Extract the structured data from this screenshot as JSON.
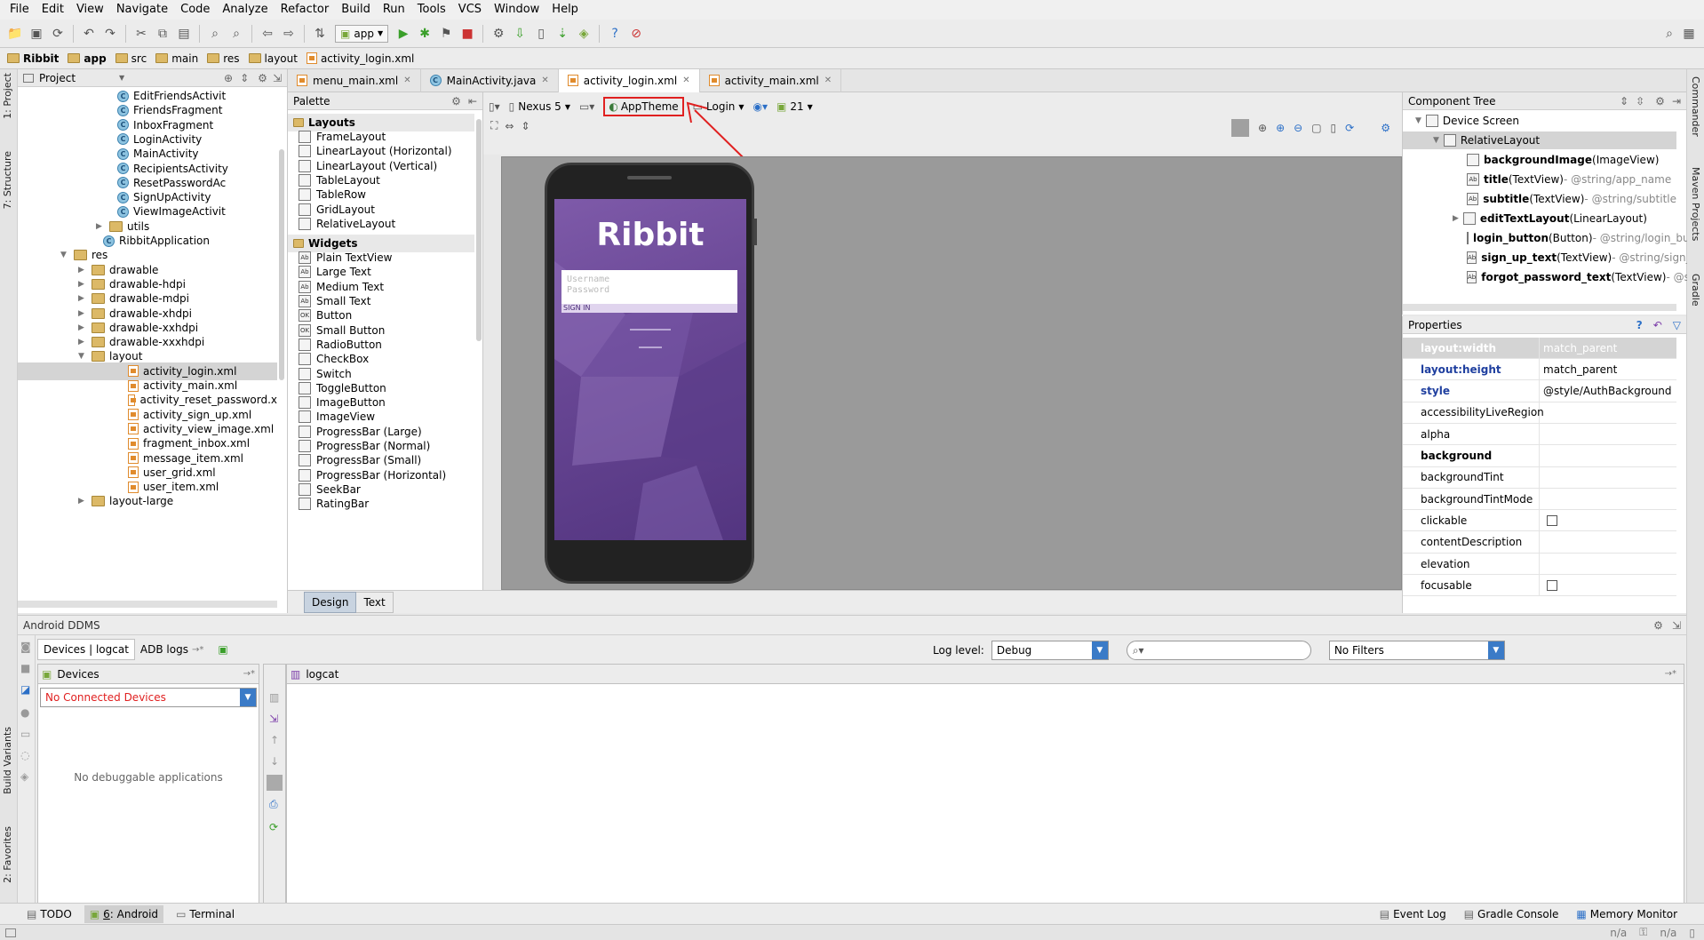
{
  "menu": [
    "File",
    "Edit",
    "View",
    "Navigate",
    "Code",
    "Analyze",
    "Refactor",
    "Build",
    "Run",
    "Tools",
    "VCS",
    "Window",
    "Help"
  ],
  "toolbar": {
    "run_config": "app"
  },
  "breadcrumb": [
    "Ribbit",
    "app",
    "src",
    "main",
    "res",
    "layout",
    "activity_login.xml"
  ],
  "left_strip": {
    "project": "1: Project",
    "structure": "7: Structure",
    "build_variants": "Build Variants",
    "favorites": "2: Favorites"
  },
  "right_strip": {
    "commander": "Commander",
    "maven": "Maven Projects",
    "gradle": "Gradle"
  },
  "project_panel": {
    "title": "Project",
    "items": [
      {
        "label": "EditFriendsActivit",
        "kind": "class",
        "indent": 132
      },
      {
        "label": "FriendsFragment",
        "kind": "class",
        "indent": 132
      },
      {
        "label": "InboxFragment",
        "kind": "class",
        "indent": 132
      },
      {
        "label": "LoginActivity",
        "kind": "class",
        "indent": 132
      },
      {
        "label": "MainActivity",
        "kind": "class",
        "indent": 132
      },
      {
        "label": "RecipientsActivity",
        "kind": "class",
        "indent": 132
      },
      {
        "label": "ResetPasswordAc",
        "kind": "class",
        "indent": 132
      },
      {
        "label": "SignUpActivity",
        "kind": "class",
        "indent": 132
      },
      {
        "label": "ViewImageActivit",
        "kind": "class",
        "indent": 132
      },
      {
        "label": "utils",
        "kind": "folder",
        "indent": 124,
        "arrow": "▶"
      },
      {
        "label": "RibbitApplication",
        "kind": "class",
        "indent": 116
      },
      {
        "label": "res",
        "kind": "folder",
        "indent": 84,
        "arrow": "▼"
      },
      {
        "label": "drawable",
        "kind": "folder",
        "indent": 104,
        "arrow": "▶"
      },
      {
        "label": "drawable-hdpi",
        "kind": "folder",
        "indent": 104,
        "arrow": "▶"
      },
      {
        "label": "drawable-mdpi",
        "kind": "folder",
        "indent": 104,
        "arrow": "▶"
      },
      {
        "label": "drawable-xhdpi",
        "kind": "folder",
        "indent": 104,
        "arrow": "▶"
      },
      {
        "label": "drawable-xxhdpi",
        "kind": "folder",
        "indent": 104,
        "arrow": "▶"
      },
      {
        "label": "drawable-xxxhdpi",
        "kind": "folder",
        "indent": 104,
        "arrow": "▶"
      },
      {
        "label": "layout",
        "kind": "folder",
        "indent": 104,
        "arrow": "▼"
      },
      {
        "label": "activity_login.xml",
        "kind": "xml",
        "indent": 144,
        "selected": true
      },
      {
        "label": "activity_main.xml",
        "kind": "xml",
        "indent": 144
      },
      {
        "label": "activity_reset_password.x",
        "kind": "xml",
        "indent": 144
      },
      {
        "label": "activity_sign_up.xml",
        "kind": "xml",
        "indent": 144
      },
      {
        "label": "activity_view_image.xml",
        "kind": "xml",
        "indent": 144
      },
      {
        "label": "fragment_inbox.xml",
        "kind": "xml",
        "indent": 144
      },
      {
        "label": "message_item.xml",
        "kind": "xml",
        "indent": 144
      },
      {
        "label": "user_grid.xml",
        "kind": "xml",
        "indent": 144
      },
      {
        "label": "user_item.xml",
        "kind": "xml",
        "indent": 144
      },
      {
        "label": "layout-large",
        "kind": "folder",
        "indent": 104,
        "arrow": "▶"
      }
    ]
  },
  "editor_tabs": [
    {
      "label": "menu_main.xml",
      "kind": "xml"
    },
    {
      "label": "MainActivity.java",
      "kind": "class"
    },
    {
      "label": "activity_login.xml",
      "kind": "xml",
      "active": true
    },
    {
      "label": "activity_main.xml",
      "kind": "xml"
    }
  ],
  "palette": {
    "title": "Palette",
    "sections": [
      {
        "name": "Layouts",
        "items": [
          "FrameLayout",
          "LinearLayout (Horizontal)",
          "LinearLayout (Vertical)",
          "TableLayout",
          "TableRow",
          "GridLayout",
          "RelativeLayout"
        ]
      },
      {
        "name": "Widgets",
        "items": [
          "Plain TextView",
          "Large Text",
          "Medium Text",
          "Small Text",
          "Button",
          "Small Button",
          "RadioButton",
          "CheckBox",
          "Switch",
          "ToggleButton",
          "ImageButton",
          "ImageView",
          "ProgressBar (Large)",
          "ProgressBar (Normal)",
          "ProgressBar (Small)",
          "ProgressBar (Horizontal)",
          "SeekBar",
          "RatingBar"
        ]
      }
    ]
  },
  "design_toolbar": {
    "device": "Nexus 5",
    "theme": "AppTheme",
    "activity": "Login",
    "api": "21"
  },
  "preview": {
    "title": "Ribbit",
    "username_hint": "Username",
    "password_hint": "Password",
    "sign_in": "SIGN IN"
  },
  "design_tabs": {
    "design": "Design",
    "text": "Text"
  },
  "component_tree": {
    "title": "Component Tree",
    "items": [
      {
        "name": "Device Screen",
        "type": "",
        "extra": "",
        "indent": 30
      },
      {
        "name": "RelativeLayout",
        "type": "",
        "extra": "",
        "indent": 50
      },
      {
        "name": "backgroundImage",
        "type": " (ImageView)",
        "extra": "",
        "indent": 72
      },
      {
        "name": "title",
        "type": " (TextView)",
        "extra": " - @string/app_name",
        "indent": 72
      },
      {
        "name": "subtitle",
        "type": " (TextView)",
        "extra": " - @string/subtitle",
        "indent": 72
      },
      {
        "name": "editTextLayout",
        "type": " (LinearLayout)",
        "extra": "",
        "indent": 72
      },
      {
        "name": "login_button",
        "type": " (Button)",
        "extra": " - @string/login_butto",
        "indent": 72
      },
      {
        "name": "sign_up_text",
        "type": " (TextView)",
        "extra": " - @string/sign_up_te",
        "indent": 72
      },
      {
        "name": "forgot_password_text",
        "type": " (TextView)",
        "extra": " - @string/",
        "indent": 72
      }
    ]
  },
  "properties": {
    "title": "Properties",
    "rows": [
      {
        "name": "layout:width",
        "value": "match_parent",
        "style": "header"
      },
      {
        "name": "layout:height",
        "value": "match_parent",
        "style": "blue"
      },
      {
        "name": "style",
        "value": "@style/AuthBackground",
        "style": "blue"
      },
      {
        "name": "accessibilityLiveRegion",
        "value": "",
        "style": ""
      },
      {
        "name": "alpha",
        "value": "",
        "style": ""
      },
      {
        "name": "background",
        "value": "",
        "style": "bold"
      },
      {
        "name": "backgroundTint",
        "value": "",
        "style": ""
      },
      {
        "name": "backgroundTintMode",
        "value": "",
        "style": ""
      },
      {
        "name": "clickable",
        "value": "",
        "style": "",
        "checkbox": true
      },
      {
        "name": "contentDescription",
        "value": "",
        "style": ""
      },
      {
        "name": "elevation",
        "value": "",
        "style": ""
      },
      {
        "name": "focusable",
        "value": "",
        "style": "",
        "checkbox": true
      }
    ]
  },
  "ddms": {
    "title": "Android DDMS",
    "tab_devices": "Devices | logcat",
    "tab_adb": "ADB logs",
    "log_level_label": "Log level:",
    "log_level": "Debug",
    "search_placeholder": "",
    "filter": "No Filters",
    "devices_title": "Devices",
    "devices_select": "No Connected Devices",
    "no_apps": "No debuggable applications",
    "logcat_title": "logcat"
  },
  "status_tabs": {
    "todo": "TODO",
    "android_num": "6",
    "android": ": Android",
    "terminal": "Terminal",
    "event_log": "Event Log",
    "gradle_console": "Gradle Console",
    "memory_monitor": "Memory Monitor"
  },
  "status_bar": {
    "na1": "n/a",
    "na2": "n/a"
  },
  "colors": {
    "accent_red": "#e02020",
    "purple": "#6a4896",
    "blue_text": "#1f3f9f"
  }
}
